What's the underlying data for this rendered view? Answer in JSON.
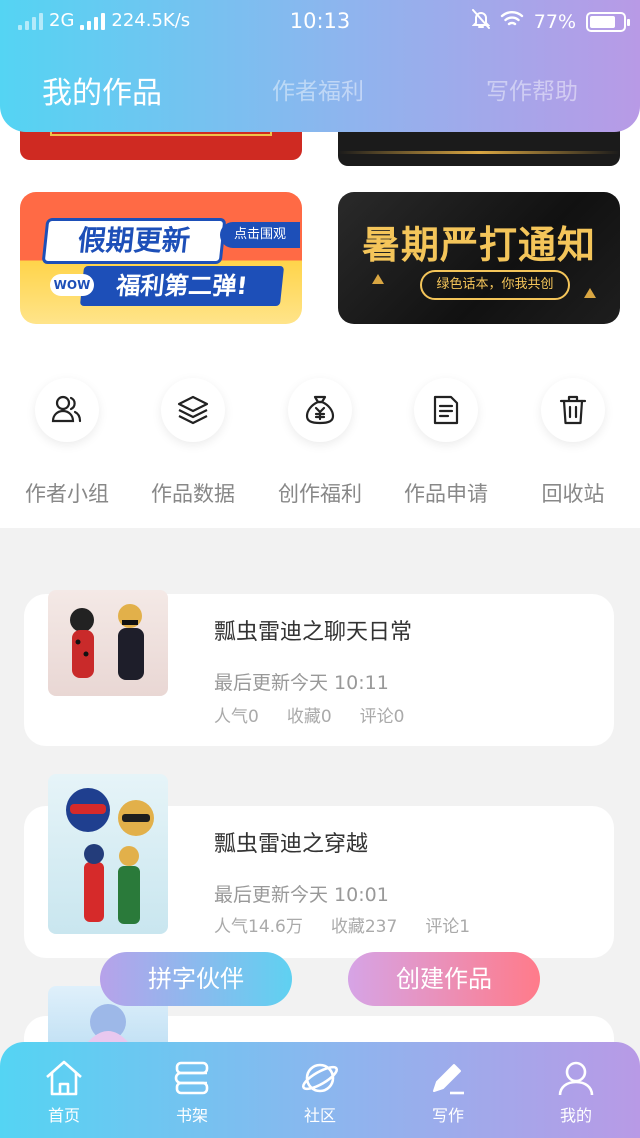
{
  "status_bar": {
    "network": "2G",
    "speed": "224.5K/s",
    "time": "10:13",
    "battery": "77%",
    "battery_level": 0.77
  },
  "top_tabs": [
    {
      "label": "我的作品",
      "active": true
    },
    {
      "label": "作者福利",
      "active": false
    },
    {
      "label": "写作帮助",
      "active": false
    }
  ],
  "banners": {
    "holiday": {
      "title": "假期更新",
      "click": "点击围观",
      "wow": "WOW",
      "subtitle": "福利第二弹!"
    },
    "summer": {
      "title": "暑期严打通知",
      "subtitle": "绿色话本，你我共创"
    }
  },
  "quick_entries": [
    {
      "label": "作者小组",
      "icon": "users-icon"
    },
    {
      "label": "作品数据",
      "icon": "layers-icon"
    },
    {
      "label": "创作福利",
      "icon": "money-bag-icon"
    },
    {
      "label": "作品申请",
      "icon": "document-icon"
    },
    {
      "label": "回收站",
      "icon": "trash-icon"
    }
  ],
  "works": [
    {
      "title": "瓢虫雷迪之聊天日常",
      "updated": "最后更新今天 10:11",
      "popularity": "人气0",
      "favorites": "收藏0",
      "comments": "评论0"
    },
    {
      "title": "瓢虫雷迪之穿越",
      "updated": "最后更新今天 10:01",
      "popularity": "人气14.6万",
      "favorites": "收藏237",
      "comments": "评论1"
    }
  ],
  "buttons": {
    "partner": "拼字伙伴",
    "create": "创建作品"
  },
  "bottom_nav": [
    {
      "label": "首页",
      "icon": "home-icon"
    },
    {
      "label": "书架",
      "icon": "bookshelf-icon"
    },
    {
      "label": "社区",
      "icon": "planet-icon"
    },
    {
      "label": "写作",
      "icon": "pen-icon"
    },
    {
      "label": "我的",
      "icon": "user-icon"
    }
  ]
}
